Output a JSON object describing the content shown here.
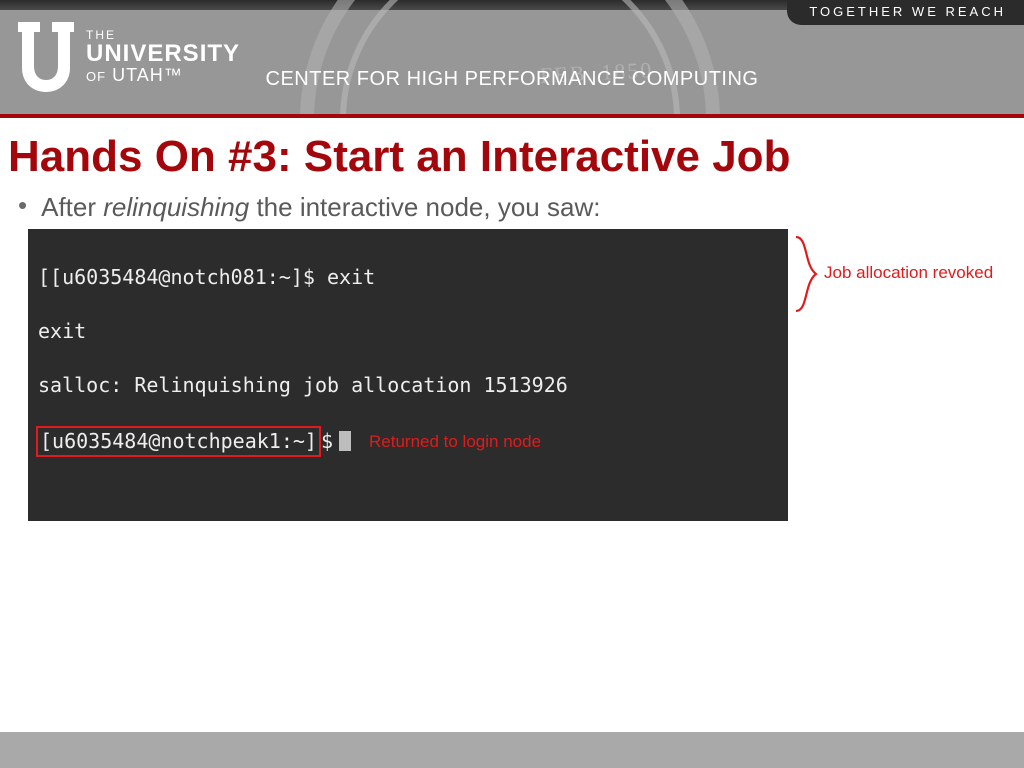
{
  "header": {
    "tagline": "TOGETHER WE REACH",
    "logo_the": "THE",
    "logo_univ": "UNIVERSITY",
    "logo_of": "OF",
    "logo_utah": "UTAH™",
    "center_label": "CENTER FOR HIGH PERFORMANCE COMPUTING",
    "seal_hint": "FEB.     1850"
  },
  "slide": {
    "title": "Hands On #3: Start an Interactive Job",
    "bullet_pre": "After ",
    "bullet_italic": "relinquishing",
    "bullet_post": " the interactive node, you saw:"
  },
  "terminal": {
    "line1": "[[u6035484@notch081:~]$ exit",
    "line2": "exit",
    "line3": "salloc: Relinquishing job allocation 1513926",
    "line4_prompt": "[u6035484@notchpeak1:~]",
    "line4_dollar": "$"
  },
  "annotations": {
    "returned": "Returned to login node",
    "revoked": "Job allocation revoked"
  }
}
